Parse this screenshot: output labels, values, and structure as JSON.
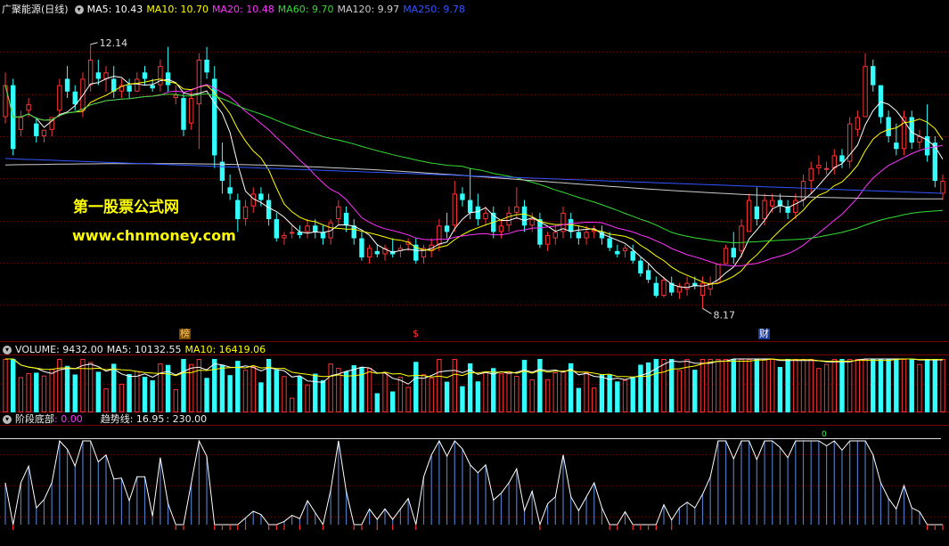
{
  "header": {
    "title": "广聚能源(日线)",
    "ma": [
      {
        "label": "MA5: 10.43",
        "color": "#ffffff"
      },
      {
        "label": "MA10: 10.70",
        "color": "#ffff00"
      },
      {
        "label": "MA20: 10.48",
        "color": "#ff33ff"
      },
      {
        "label": "MA60: 9.70",
        "color": "#33dd33"
      },
      {
        "label": "MA120: 9.97",
        "color": "#cccccc"
      },
      {
        "label": "MA250: 9.78",
        "color": "#3355ff"
      }
    ]
  },
  "watermark": {
    "line1": "第一股票公式网",
    "line2": "www.chnmoney.com"
  },
  "price_annotations": {
    "high": "12.14",
    "low": "8.17"
  },
  "event_tags": [
    {
      "text": "榜",
      "color": "#ffcc66",
      "bg": "#7a4a00"
    },
    {
      "text": "$",
      "color": "#ff3333",
      "bg": "#000000"
    },
    {
      "text": "财",
      "color": "#ffffff",
      "bg": "#1a3aa0"
    }
  ],
  "volume_header": {
    "label": "VOLUME: 9432.00",
    "ma5": "MA5: 10132.55",
    "ma10": "MA10: 16419.06"
  },
  "indicator_header": {
    "name": "阶段底部",
    "name_value": ": 0.00",
    "trend_label": "趋势线: 16.95",
    "extra": ": 230.00"
  },
  "indicator_marker": "0",
  "colors": {
    "up": "#ff3333",
    "down": "#33ffff",
    "grid": "#7a0000",
    "ma5": "#ffffff",
    "ma10": "#ffff00",
    "ma20": "#ff33ff",
    "ma60": "#33dd33",
    "ma120": "#cccccc",
    "ma250": "#3355ff",
    "indicator_bar": "#4f78c0",
    "indicator_line": "#ffffff"
  },
  "chart_data": [
    {
      "type": "candlestick",
      "title": "广聚能源(日线)",
      "ylim": [
        7.6,
        12.5
      ],
      "points": [
        {
          "o": 11.0,
          "h": 11.7,
          "l": 10.9,
          "c": 11.5
        },
        {
          "o": 11.5,
          "h": 11.6,
          "l": 10.4,
          "c": 10.5
        },
        {
          "o": 10.8,
          "h": 11.1,
          "l": 10.7,
          "c": 11.0
        },
        {
          "o": 11.1,
          "h": 11.3,
          "l": 11.0,
          "c": 11.2
        },
        {
          "o": 10.9,
          "h": 11.0,
          "l": 10.6,
          "c": 10.7
        },
        {
          "o": 10.7,
          "h": 10.8,
          "l": 10.6,
          "c": 10.8
        },
        {
          "o": 10.8,
          "h": 11.0,
          "l": 10.7,
          "c": 11.0
        },
        {
          "o": 11.1,
          "h": 11.6,
          "l": 11.0,
          "c": 11.5
        },
        {
          "o": 11.6,
          "h": 11.8,
          "l": 11.3,
          "c": 11.4
        },
        {
          "o": 11.4,
          "h": 11.5,
          "l": 11.1,
          "c": 11.2
        },
        {
          "o": 11.1,
          "h": 11.7,
          "l": 11.0,
          "c": 11.6
        },
        {
          "o": 11.5,
          "h": 12.14,
          "l": 11.4,
          "c": 11.9
        },
        {
          "o": 11.7,
          "h": 11.9,
          "l": 11.5,
          "c": 11.6
        },
        {
          "o": 11.6,
          "h": 11.8,
          "l": 11.4,
          "c": 11.7
        },
        {
          "o": 11.6,
          "h": 11.8,
          "l": 11.3,
          "c": 11.4
        },
        {
          "o": 11.4,
          "h": 11.6,
          "l": 11.3,
          "c": 11.5
        },
        {
          "o": 11.5,
          "h": 11.6,
          "l": 11.3,
          "c": 11.4
        },
        {
          "o": 11.4,
          "h": 11.7,
          "l": 11.4,
          "c": 11.6
        },
        {
          "o": 11.7,
          "h": 11.8,
          "l": 11.5,
          "c": 11.6
        },
        {
          "o": 11.5,
          "h": 11.6,
          "l": 11.4,
          "c": 11.45
        },
        {
          "o": 11.5,
          "h": 11.9,
          "l": 11.4,
          "c": 11.8
        },
        {
          "o": 11.7,
          "h": 12.1,
          "l": 11.4,
          "c": 11.5
        },
        {
          "o": 11.3,
          "h": 11.5,
          "l": 11.2,
          "c": 11.35
        },
        {
          "o": 11.3,
          "h": 11.4,
          "l": 10.7,
          "c": 10.8
        },
        {
          "o": 10.9,
          "h": 11.4,
          "l": 10.8,
          "c": 11.3
        },
        {
          "o": 11.2,
          "h": 12.0,
          "l": 10.5,
          "c": 11.9
        },
        {
          "o": 11.9,
          "h": 12.1,
          "l": 11.6,
          "c": 11.7
        },
        {
          "o": 11.6,
          "h": 11.8,
          "l": 10.2,
          "c": 10.4
        },
        {
          "o": 10.3,
          "h": 10.6,
          "l": 9.8,
          "c": 10.0
        },
        {
          "o": 9.9,
          "h": 10.1,
          "l": 9.7,
          "c": 9.8
        },
        {
          "o": 9.7,
          "h": 9.8,
          "l": 9.2,
          "c": 9.4
        },
        {
          "o": 9.4,
          "h": 9.7,
          "l": 9.3,
          "c": 9.6
        },
        {
          "o": 9.6,
          "h": 9.9,
          "l": 9.5,
          "c": 9.8
        },
        {
          "o": 9.8,
          "h": 9.9,
          "l": 9.6,
          "c": 9.7
        },
        {
          "o": 9.7,
          "h": 9.8,
          "l": 9.3,
          "c": 9.4
        },
        {
          "o": 9.4,
          "h": 9.5,
          "l": 9.05,
          "c": 9.1
        },
        {
          "o": 9.1,
          "h": 9.2,
          "l": 9.0,
          "c": 9.15
        },
        {
          "o": 9.2,
          "h": 9.3,
          "l": 9.1,
          "c": 9.2
        },
        {
          "o": 9.2,
          "h": 9.3,
          "l": 9.1,
          "c": 9.15
        },
        {
          "o": 9.2,
          "h": 9.4,
          "l": 9.1,
          "c": 9.3
        },
        {
          "o": 9.3,
          "h": 9.4,
          "l": 9.1,
          "c": 9.2
        },
        {
          "o": 9.2,
          "h": 9.3,
          "l": 9.0,
          "c": 9.1
        },
        {
          "o": 9.1,
          "h": 9.4,
          "l": 9.0,
          "c": 9.35
        },
        {
          "o": 9.4,
          "h": 9.7,
          "l": 9.3,
          "c": 9.6
        },
        {
          "o": 9.5,
          "h": 9.6,
          "l": 9.2,
          "c": 9.3
        },
        {
          "o": 9.3,
          "h": 9.4,
          "l": 9.0,
          "c": 9.1
        },
        {
          "o": 9.1,
          "h": 9.2,
          "l": 8.75,
          "c": 8.8
        },
        {
          "o": 8.8,
          "h": 9.0,
          "l": 8.7,
          "c": 8.95
        },
        {
          "o": 8.9,
          "h": 9.0,
          "l": 8.8,
          "c": 8.85
        },
        {
          "o": 8.85,
          "h": 9.0,
          "l": 8.75,
          "c": 8.95
        },
        {
          "o": 8.9,
          "h": 9.1,
          "l": 8.8,
          "c": 8.85
        },
        {
          "o": 8.9,
          "h": 9.0,
          "l": 8.8,
          "c": 8.95
        },
        {
          "o": 9.0,
          "h": 9.1,
          "l": 8.9,
          "c": 9.05
        },
        {
          "o": 9.0,
          "h": 9.1,
          "l": 8.7,
          "c": 8.75
        },
        {
          "o": 8.8,
          "h": 9.0,
          "l": 8.7,
          "c": 8.95
        },
        {
          "o": 8.9,
          "h": 9.1,
          "l": 8.8,
          "c": 9.0
        },
        {
          "o": 9.0,
          "h": 9.4,
          "l": 8.9,
          "c": 9.3
        },
        {
          "o": 9.3,
          "h": 9.5,
          "l": 9.1,
          "c": 9.2
        },
        {
          "o": 9.3,
          "h": 10.0,
          "l": 9.2,
          "c": 9.8
        },
        {
          "o": 9.8,
          "h": 9.9,
          "l": 9.6,
          "c": 9.7
        },
        {
          "o": 9.7,
          "h": 10.2,
          "l": 9.4,
          "c": 9.5
        },
        {
          "o": 9.6,
          "h": 9.8,
          "l": 9.3,
          "c": 9.4
        },
        {
          "o": 9.4,
          "h": 9.6,
          "l": 9.3,
          "c": 9.5
        },
        {
          "o": 9.5,
          "h": 9.6,
          "l": 9.1,
          "c": 9.2
        },
        {
          "o": 9.2,
          "h": 9.4,
          "l": 9.1,
          "c": 9.3
        },
        {
          "o": 9.3,
          "h": 9.6,
          "l": 9.2,
          "c": 9.5
        },
        {
          "o": 9.5,
          "h": 9.9,
          "l": 9.4,
          "c": 9.6
        },
        {
          "o": 9.6,
          "h": 9.7,
          "l": 9.2,
          "c": 9.3
        },
        {
          "o": 9.3,
          "h": 9.5,
          "l": 9.2,
          "c": 9.4
        },
        {
          "o": 9.4,
          "h": 9.5,
          "l": 8.95,
          "c": 9.0
        },
        {
          "o": 9.0,
          "h": 9.2,
          "l": 8.9,
          "c": 9.15
        },
        {
          "o": 9.1,
          "h": 9.3,
          "l": 9.0,
          "c": 9.2
        },
        {
          "o": 9.2,
          "h": 9.6,
          "l": 9.1,
          "c": 9.5
        },
        {
          "o": 9.4,
          "h": 9.5,
          "l": 9.1,
          "c": 9.2
        },
        {
          "o": 9.2,
          "h": 9.3,
          "l": 9.0,
          "c": 9.1
        },
        {
          "o": 9.1,
          "h": 9.3,
          "l": 9.0,
          "c": 9.2
        },
        {
          "o": 9.2,
          "h": 9.3,
          "l": 9.1,
          "c": 9.25
        },
        {
          "o": 9.2,
          "h": 9.3,
          "l": 9.0,
          "c": 9.1
        },
        {
          "o": 9.1,
          "h": 9.2,
          "l": 8.9,
          "c": 8.95
        },
        {
          "o": 8.9,
          "h": 9.0,
          "l": 8.8,
          "c": 8.85
        },
        {
          "o": 8.9,
          "h": 9.0,
          "l": 8.8,
          "c": 8.95
        },
        {
          "o": 8.9,
          "h": 9.0,
          "l": 8.7,
          "c": 8.75
        },
        {
          "o": 8.75,
          "h": 8.8,
          "l": 8.5,
          "c": 8.55
        },
        {
          "o": 8.6,
          "h": 8.7,
          "l": 8.4,
          "c": 8.45
        },
        {
          "o": 8.4,
          "h": 8.5,
          "l": 8.17,
          "c": 8.2
        },
        {
          "o": 8.2,
          "h": 8.5,
          "l": 8.17,
          "c": 8.45
        },
        {
          "o": 8.4,
          "h": 8.5,
          "l": 8.2,
          "c": 8.25
        },
        {
          "o": 8.25,
          "h": 8.4,
          "l": 8.15,
          "c": 8.35
        },
        {
          "o": 8.3,
          "h": 8.5,
          "l": 8.2,
          "c": 8.4
        },
        {
          "o": 8.4,
          "h": 8.5,
          "l": 8.3,
          "c": 8.35
        },
        {
          "o": 8.2,
          "h": 8.5,
          "l": 8.0,
          "c": 8.4
        },
        {
          "o": 8.3,
          "h": 8.5,
          "l": 8.2,
          "c": 8.4
        },
        {
          "o": 8.4,
          "h": 8.7,
          "l": 8.4,
          "c": 8.7
        },
        {
          "o": 8.7,
          "h": 9.0,
          "l": 8.7,
          "c": 8.95
        },
        {
          "o": 8.95,
          "h": 9.2,
          "l": 8.7,
          "c": 8.8
        },
        {
          "o": 8.9,
          "h": 9.4,
          "l": 8.8,
          "c": 9.3
        },
        {
          "o": 9.2,
          "h": 9.8,
          "l": 9.2,
          "c": 9.7
        },
        {
          "o": 9.6,
          "h": 9.9,
          "l": 9.3,
          "c": 9.4
        },
        {
          "o": 9.4,
          "h": 9.8,
          "l": 9.3,
          "c": 9.7
        },
        {
          "o": 9.6,
          "h": 9.8,
          "l": 9.5,
          "c": 9.7
        },
        {
          "o": 9.7,
          "h": 9.8,
          "l": 9.5,
          "c": 9.6
        },
        {
          "o": 9.6,
          "h": 9.7,
          "l": 9.4,
          "c": 9.5
        },
        {
          "o": 9.5,
          "h": 9.8,
          "l": 9.4,
          "c": 9.7
        },
        {
          "o": 9.7,
          "h": 10.1,
          "l": 9.6,
          "c": 10.0
        },
        {
          "o": 10.0,
          "h": 10.3,
          "l": 9.8,
          "c": 10.2
        },
        {
          "o": 10.2,
          "h": 10.4,
          "l": 10.1,
          "c": 10.25
        },
        {
          "o": 10.2,
          "h": 10.3,
          "l": 10.1,
          "c": 10.2
        },
        {
          "o": 10.2,
          "h": 10.5,
          "l": 10.1,
          "c": 10.4
        },
        {
          "o": 10.4,
          "h": 10.5,
          "l": 10.2,
          "c": 10.3
        },
        {
          "o": 10.3,
          "h": 11.0,
          "l": 10.2,
          "c": 10.9
        },
        {
          "o": 10.8,
          "h": 11.1,
          "l": 10.7,
          "c": 11.0
        },
        {
          "o": 11.0,
          "h": 12.0,
          "l": 11.0,
          "c": 11.8
        },
        {
          "o": 11.8,
          "h": 11.9,
          "l": 11.4,
          "c": 11.5
        },
        {
          "o": 11.5,
          "h": 11.5,
          "l": 10.9,
          "c": 11.0
        },
        {
          "o": 11.0,
          "h": 11.1,
          "l": 10.6,
          "c": 10.7
        },
        {
          "o": 10.6,
          "h": 10.9,
          "l": 10.4,
          "c": 10.5
        },
        {
          "o": 10.5,
          "h": 11.1,
          "l": 10.4,
          "c": 11.0
        },
        {
          "o": 11.0,
          "h": 11.1,
          "l": 10.5,
          "c": 10.6
        },
        {
          "o": 10.6,
          "h": 10.8,
          "l": 10.5,
          "c": 10.7
        },
        {
          "o": 10.7,
          "h": 11.2,
          "l": 10.3,
          "c": 10.4
        },
        {
          "o": 10.6,
          "h": 10.7,
          "l": 9.9,
          "c": 10.0
        },
        {
          "o": 9.8,
          "h": 10.1,
          "l": 9.7,
          "c": 10.0
        }
      ]
    }
  ]
}
